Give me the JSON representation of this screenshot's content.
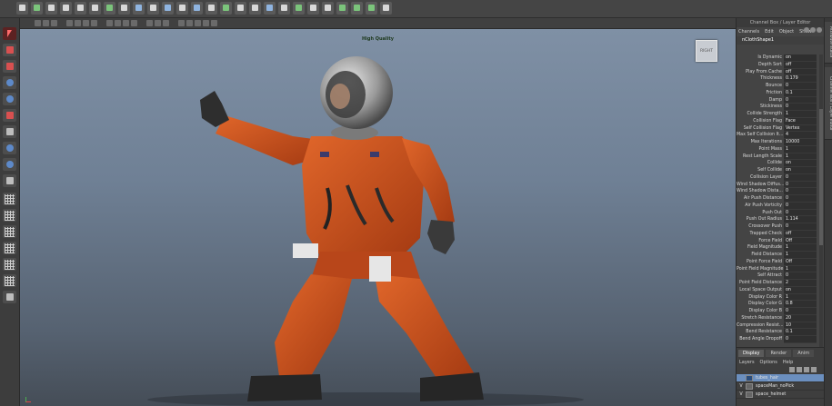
{
  "viewport": {
    "label": "High Quality",
    "view_cube_label": "RIGHT"
  },
  "channel_box": {
    "title": "Channel Box / Layer Editor",
    "menu": [
      "Channels",
      "Edit",
      "Object",
      "Show"
    ],
    "node_name": "nClothShape1",
    "attributes": [
      {
        "name": "Is Dynamic",
        "value": "on"
      },
      {
        "name": "Depth Sort",
        "value": "off"
      },
      {
        "name": "Play From Cache",
        "value": "off"
      },
      {
        "name": "Thickness",
        "value": "0.179"
      },
      {
        "name": "Bounce",
        "value": "0"
      },
      {
        "name": "Friction",
        "value": "0.1"
      },
      {
        "name": "Damp",
        "value": "0"
      },
      {
        "name": "Stickiness",
        "value": "0"
      },
      {
        "name": "Collide Strength",
        "value": "1"
      },
      {
        "name": "Collision Flag",
        "value": "Face"
      },
      {
        "name": "Self Collision Flag",
        "value": "Vertex"
      },
      {
        "name": "Max Self Collision It...",
        "value": "4"
      },
      {
        "name": "Max Iterations",
        "value": "10000"
      },
      {
        "name": "Point Mass",
        "value": "1"
      },
      {
        "name": "Rest Length Scale",
        "value": "1"
      },
      {
        "name": "Collide",
        "value": "on"
      },
      {
        "name": "Self Collide",
        "value": "on"
      },
      {
        "name": "Collision Layer",
        "value": "0"
      },
      {
        "name": "Wind Shadow Diffus...",
        "value": "0"
      },
      {
        "name": "Wind Shadow Dista...",
        "value": "0"
      },
      {
        "name": "Air Push Distance",
        "value": "0"
      },
      {
        "name": "Air Push Vorticity",
        "value": "0"
      },
      {
        "name": "Push Out",
        "value": "0"
      },
      {
        "name": "Push Out Radius",
        "value": "1.114"
      },
      {
        "name": "Crossover Push",
        "value": "0"
      },
      {
        "name": "Trapped Check",
        "value": "off"
      },
      {
        "name": "Force Field",
        "value": "Off"
      },
      {
        "name": "Field Magnitude",
        "value": "1"
      },
      {
        "name": "Field Distance",
        "value": "1"
      },
      {
        "name": "Point Force Field",
        "value": "Off"
      },
      {
        "name": "Point Field Magnitude",
        "value": "1"
      },
      {
        "name": "Self Attract",
        "value": "0"
      },
      {
        "name": "Point Field Distance",
        "value": "2"
      },
      {
        "name": "Local Space Output",
        "value": "on"
      },
      {
        "name": "Display Color R",
        "value": "1"
      },
      {
        "name": "Display Color G",
        "value": "0.8"
      },
      {
        "name": "Display Color B",
        "value": "0"
      },
      {
        "name": "Stretch Resistance",
        "value": "20"
      },
      {
        "name": "Compression Resist...",
        "value": "10"
      },
      {
        "name": "Bend Resistance",
        "value": "0.1"
      },
      {
        "name": "Bend Angle Dropoff",
        "value": "0"
      }
    ]
  },
  "layer_editor": {
    "tabs": [
      "Display",
      "Render",
      "Anim"
    ],
    "active_tab": "Display",
    "menu": [
      "Layers",
      "Options",
      "Help"
    ],
    "layers": [
      {
        "vis": "",
        "name": "tubes_hair",
        "selected": true
      },
      {
        "vis": "V",
        "name": "spaceMan_noPick",
        "selected": false
      },
      {
        "vis": "V",
        "name": "space_helmet",
        "selected": false
      }
    ]
  },
  "side_tabs": [
    "Attribute Editor",
    "Channel Box / Layer Editor"
  ],
  "colors": {
    "suit": "#d2521f",
    "suit_dark": "#8f3010",
    "viewport_top": "#7f90a5",
    "viewport_bottom": "#454d57",
    "selected_layer": "#6b8fbf"
  }
}
